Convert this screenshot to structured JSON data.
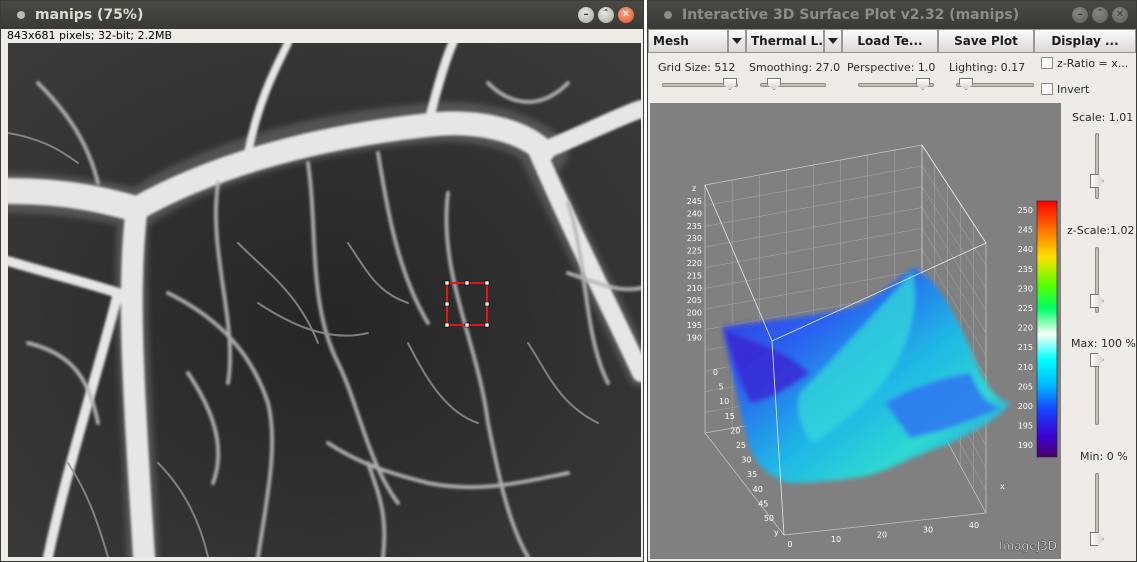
{
  "left_window": {
    "title": "manips (75%)",
    "info": "843x681 pixels; 32-bit; 2.2MB"
  },
  "right_window": {
    "title": "Interactive 3D Surface Plot v2.32  (manips)",
    "buttons": {
      "display_mode": "Mesh",
      "lut": "Thermal L...",
      "load_texture": "Load Te...",
      "save_plot": "Save Plot",
      "display": "Display ..."
    },
    "sliders": {
      "grid_size": "Grid Size: 512",
      "smoothing": "Smoothing: 27.0",
      "perspective": "Perspective: 1.0",
      "lighting": "Lighting: 0.17"
    },
    "checkboxes": {
      "z_ratio": "z-Ratio = x...",
      "invert": "Invert"
    },
    "side": {
      "scale": "Scale: 1.01",
      "z_scale": "z-Scale:1.02",
      "max": "Max: 100 %",
      "min": "Min: 0 %"
    },
    "plot": {
      "z_axis_label": "z",
      "x_axis_label": "x",
      "y_axis_label": "y",
      "z_ticks": [
        "245",
        "240",
        "235",
        "230",
        "225",
        "220",
        "215",
        "210",
        "205",
        "200",
        "195",
        "190"
      ],
      "y_ticks": [
        "0",
        "5",
        "10",
        "15",
        "20",
        "25",
        "30",
        "35",
        "40",
        "45",
        "50"
      ],
      "x_ticks": [
        "0",
        "10",
        "20",
        "30",
        "40"
      ],
      "colorbar_ticks": [
        "250",
        "245",
        "240",
        "235",
        "230",
        "225",
        "220",
        "215",
        "210",
        "205",
        "200",
        "195",
        "190"
      ],
      "watermark": "ImageJ3D"
    }
  }
}
